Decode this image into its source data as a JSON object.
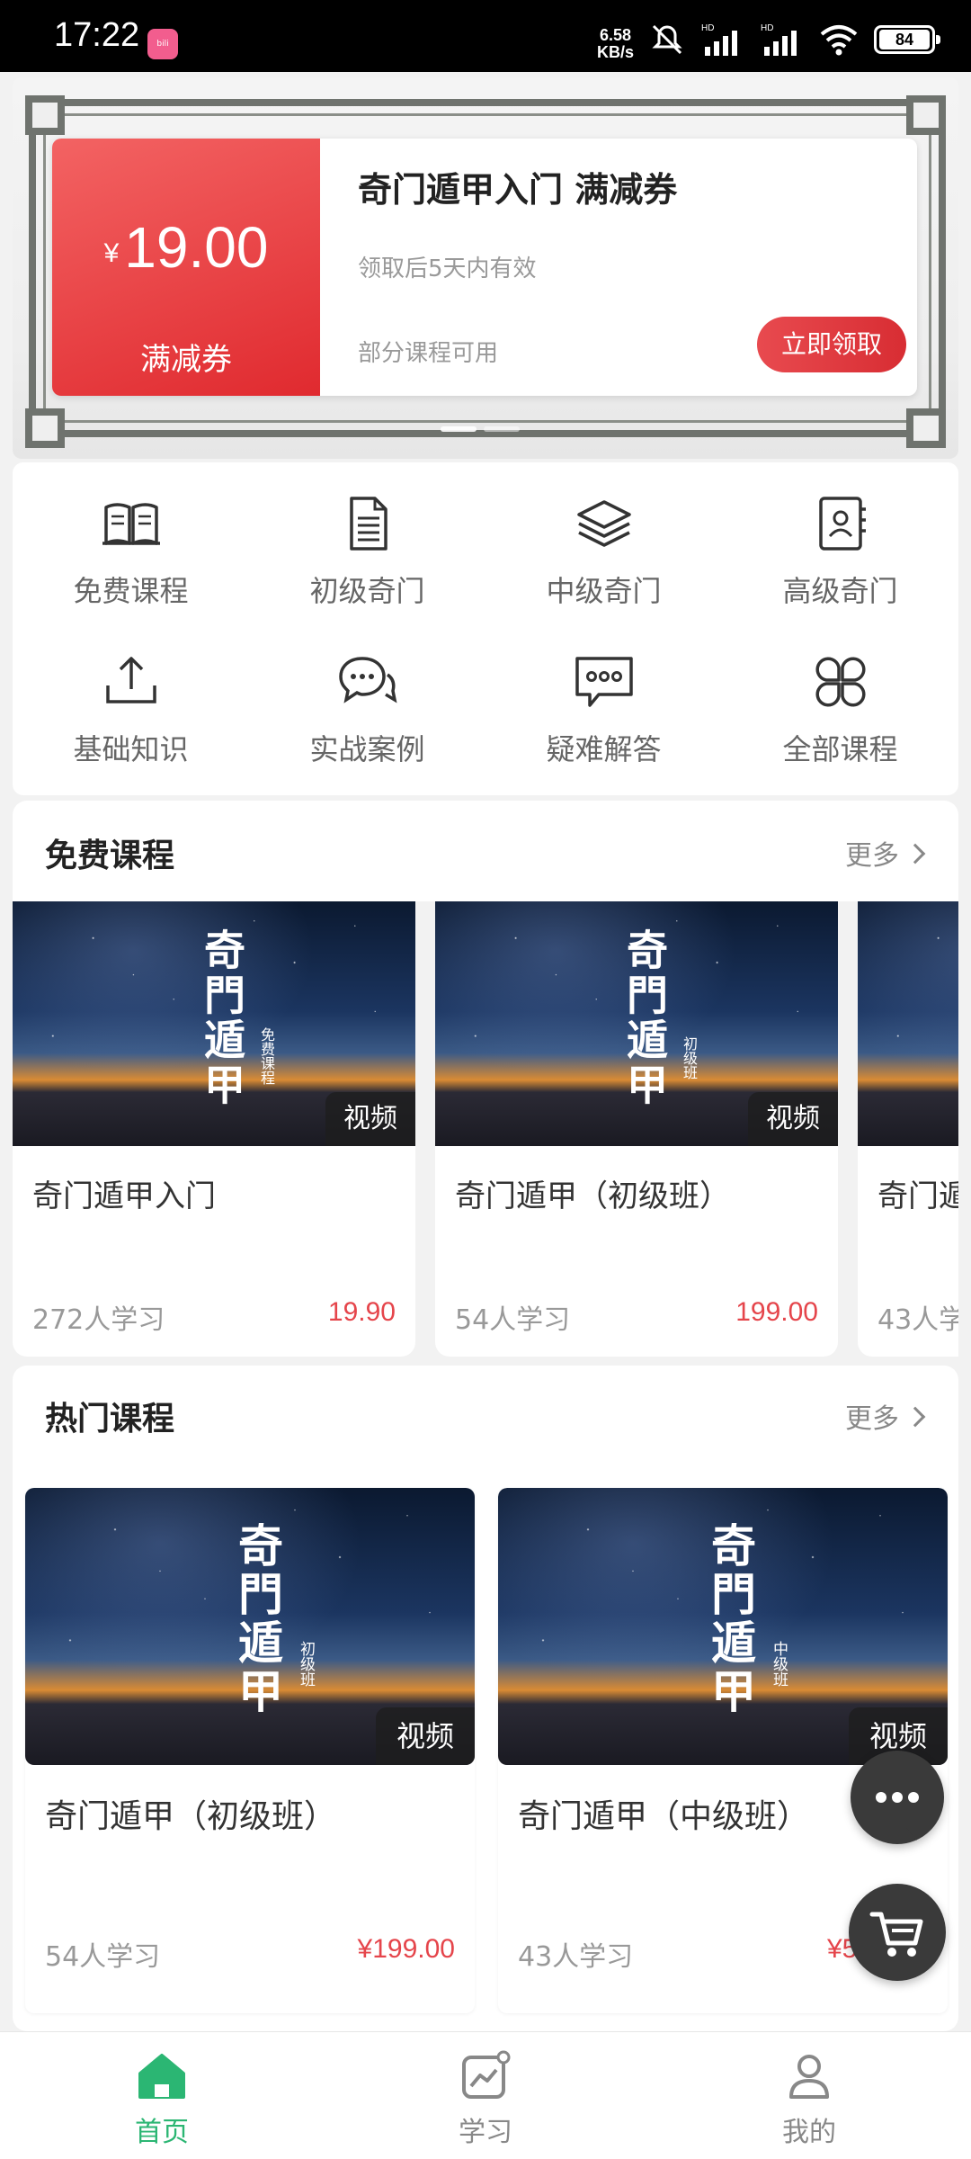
{
  "status_bar": {
    "time": "17:22",
    "net_speed_value": "6.58",
    "net_speed_unit": "KB/s",
    "battery": "84",
    "icons": [
      "bilibili-icon",
      "mute-icon",
      "signal-icon",
      "signal-icon",
      "wifi-icon",
      "battery-icon"
    ]
  },
  "banner": {
    "coupon": {
      "currency": "¥",
      "amount": "19.00",
      "type_label": "满减券",
      "title": "奇门遁甲入门 满减券",
      "validity": "领取后5天内有效",
      "scope": "部分课程可用",
      "claim_button": "立即领取"
    },
    "active_slide": 1,
    "slide_count": 2
  },
  "categories": [
    {
      "label": "免费课程",
      "icon": "book-icon"
    },
    {
      "label": "初级奇门",
      "icon": "document-icon"
    },
    {
      "label": "中级奇门",
      "icon": "layers-icon"
    },
    {
      "label": "高级奇门",
      "icon": "contact-book-icon"
    },
    {
      "label": "基础知识",
      "icon": "upload-icon"
    },
    {
      "label": "实战案例",
      "icon": "chat-bubbles-icon"
    },
    {
      "label": "疑难解答",
      "icon": "message-dots-icon"
    },
    {
      "label": "全部课程",
      "icon": "clover-grid-icon"
    }
  ],
  "free_section": {
    "title": "免费课程",
    "more": "更多",
    "cards": [
      {
        "cover_title": "奇門遁甲",
        "cover_sub": "免费课程",
        "tag": "视频",
        "title": "奇门遁甲入门",
        "learners": "272人学习",
        "price": "19.90"
      },
      {
        "cover_title": "奇門遁甲",
        "cover_sub": "初级班",
        "tag": "视频",
        "title": "奇门遁甲（初级班）",
        "learners": "54人学习",
        "price": "199.00"
      },
      {
        "cover_title": "",
        "cover_sub": "",
        "tag": "",
        "title": "奇门遁",
        "learners": "43人学",
        "price": ""
      }
    ]
  },
  "hot_section": {
    "title": "热门课程",
    "more": "更多",
    "cards": [
      {
        "cover_title": "奇門遁甲",
        "cover_sub": "初级班",
        "tag": "视频",
        "title": "奇门遁甲（初级班）",
        "learners": "54人学习",
        "price": "¥199.00"
      },
      {
        "cover_title": "奇門遁甲",
        "cover_sub": "中级班",
        "tag": "视频",
        "title": "奇门遁甲（中级班）",
        "learners": "43人学习",
        "price": "¥5"
      }
    ]
  },
  "floating": {
    "chat_icon": "chat-dots-icon",
    "cart_icon": "cart-icon"
  },
  "bottom_nav": [
    {
      "label": "首页",
      "icon": "home-icon",
      "active": true
    },
    {
      "label": "学习",
      "icon": "study-chart-icon",
      "active": false
    },
    {
      "label": "我的",
      "icon": "person-icon",
      "active": false
    }
  ],
  "colors": {
    "accent_green": "#2bb673",
    "price_red": "#e5454b",
    "coupon_red": "#e02a2f"
  }
}
